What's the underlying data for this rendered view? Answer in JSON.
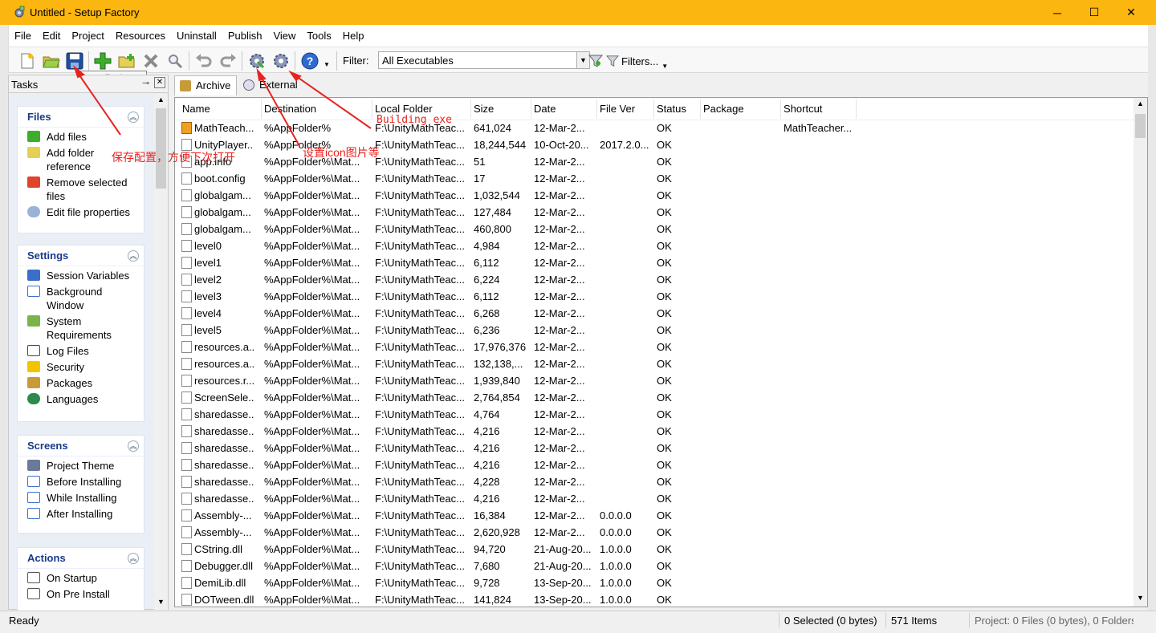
{
  "window": {
    "title": "Untitled - Setup Factory",
    "minimize": "─",
    "maximize": "☐",
    "close": "✕"
  },
  "menu": [
    "File",
    "Edit",
    "Project",
    "Resources",
    "Uninstall",
    "Publish",
    "View",
    "Tools",
    "Help"
  ],
  "toolbar": {
    "tooltip": "Save Project",
    "filter_label": "Filter:",
    "filter_value": "All Executables",
    "filters_button": "Filters..."
  },
  "tasks": {
    "title": "Tasks",
    "files": {
      "title": "Files",
      "items": [
        "Add files",
        "Add folder reference",
        "Remove selected files",
        "Edit file properties"
      ]
    },
    "settings": {
      "title": "Settings",
      "items": [
        "Session Variables",
        "Background Window",
        "System Requirements",
        "Log Files",
        "Security",
        "Packages",
        "Languages"
      ]
    },
    "screens": {
      "title": "Screens",
      "items": [
        "Project Theme",
        "Before Installing",
        "While Installing",
        "After Installing"
      ]
    },
    "actions": {
      "title": "Actions",
      "items": [
        "On Startup",
        "On Pre Install"
      ]
    }
  },
  "tabs": [
    "Archive",
    "External"
  ],
  "grid": {
    "columns": [
      "Name",
      "Destination",
      "Local Folder",
      "Size",
      "Date",
      "File Ver",
      "Status",
      "Package",
      "Shortcut"
    ],
    "rows": [
      [
        "MathTeach...",
        "%AppFolder%",
        "F:\\UnityMathTeac...",
        "641,024",
        "12-Mar-2...",
        "",
        "OK",
        "",
        "MathTeacher..."
      ],
      [
        "UnityPlayer....",
        "%AppFolder%",
        "F:\\UnityMathTeac...",
        "18,244,544",
        "10-Oct-20...",
        "2017.2.0...",
        "OK",
        "",
        ""
      ],
      [
        "app.info",
        "%AppFolder%\\Mat...",
        "F:\\UnityMathTeac...",
        "51",
        "12-Mar-2...",
        "",
        "OK",
        "",
        ""
      ],
      [
        "boot.config",
        "%AppFolder%\\Mat...",
        "F:\\UnityMathTeac...",
        "17",
        "12-Mar-2...",
        "",
        "OK",
        "",
        ""
      ],
      [
        "globalgam...",
        "%AppFolder%\\Mat...",
        "F:\\UnityMathTeac...",
        "1,032,544",
        "12-Mar-2...",
        "",
        "OK",
        "",
        ""
      ],
      [
        "globalgam...",
        "%AppFolder%\\Mat...",
        "F:\\UnityMathTeac...",
        "127,484",
        "12-Mar-2...",
        "",
        "OK",
        "",
        ""
      ],
      [
        "globalgam...",
        "%AppFolder%\\Mat...",
        "F:\\UnityMathTeac...",
        "460,800",
        "12-Mar-2...",
        "",
        "OK",
        "",
        ""
      ],
      [
        "level0",
        "%AppFolder%\\Mat...",
        "F:\\UnityMathTeac...",
        "4,984",
        "12-Mar-2...",
        "",
        "OK",
        "",
        ""
      ],
      [
        "level1",
        "%AppFolder%\\Mat...",
        "F:\\UnityMathTeac...",
        "6,112",
        "12-Mar-2...",
        "",
        "OK",
        "",
        ""
      ],
      [
        "level2",
        "%AppFolder%\\Mat...",
        "F:\\UnityMathTeac...",
        "6,224",
        "12-Mar-2...",
        "",
        "OK",
        "",
        ""
      ],
      [
        "level3",
        "%AppFolder%\\Mat...",
        "F:\\UnityMathTeac...",
        "6,112",
        "12-Mar-2...",
        "",
        "OK",
        "",
        ""
      ],
      [
        "level4",
        "%AppFolder%\\Mat...",
        "F:\\UnityMathTeac...",
        "6,268",
        "12-Mar-2...",
        "",
        "OK",
        "",
        ""
      ],
      [
        "level5",
        "%AppFolder%\\Mat...",
        "F:\\UnityMathTeac...",
        "6,236",
        "12-Mar-2...",
        "",
        "OK",
        "",
        ""
      ],
      [
        "resources.a...",
        "%AppFolder%\\Mat...",
        "F:\\UnityMathTeac...",
        "17,976,376",
        "12-Mar-2...",
        "",
        "OK",
        "",
        ""
      ],
      [
        "resources.a...",
        "%AppFolder%\\Mat...",
        "F:\\UnityMathTeac...",
        "132,138,...",
        "12-Mar-2...",
        "",
        "OK",
        "",
        ""
      ],
      [
        "resources.r...",
        "%AppFolder%\\Mat...",
        "F:\\UnityMathTeac...",
        "1,939,840",
        "12-Mar-2...",
        "",
        "OK",
        "",
        ""
      ],
      [
        "ScreenSele...",
        "%AppFolder%\\Mat...",
        "F:\\UnityMathTeac...",
        "2,764,854",
        "12-Mar-2...",
        "",
        "OK",
        "",
        ""
      ],
      [
        "sharedasse...",
        "%AppFolder%\\Mat...",
        "F:\\UnityMathTeac...",
        "4,764",
        "12-Mar-2...",
        "",
        "OK",
        "",
        ""
      ],
      [
        "sharedasse...",
        "%AppFolder%\\Mat...",
        "F:\\UnityMathTeac...",
        "4,216",
        "12-Mar-2...",
        "",
        "OK",
        "",
        ""
      ],
      [
        "sharedasse...",
        "%AppFolder%\\Mat...",
        "F:\\UnityMathTeac...",
        "4,216",
        "12-Mar-2...",
        "",
        "OK",
        "",
        ""
      ],
      [
        "sharedasse...",
        "%AppFolder%\\Mat...",
        "F:\\UnityMathTeac...",
        "4,216",
        "12-Mar-2...",
        "",
        "OK",
        "",
        ""
      ],
      [
        "sharedasse...",
        "%AppFolder%\\Mat...",
        "F:\\UnityMathTeac...",
        "4,228",
        "12-Mar-2...",
        "",
        "OK",
        "",
        ""
      ],
      [
        "sharedasse...",
        "%AppFolder%\\Mat...",
        "F:\\UnityMathTeac...",
        "4,216",
        "12-Mar-2...",
        "",
        "OK",
        "",
        ""
      ],
      [
        "Assembly-...",
        "%AppFolder%\\Mat...",
        "F:\\UnityMathTeac...",
        "16,384",
        "12-Mar-2...",
        "0.0.0.0",
        "OK",
        "",
        ""
      ],
      [
        "Assembly-...",
        "%AppFolder%\\Mat...",
        "F:\\UnityMathTeac...",
        "2,620,928",
        "12-Mar-2...",
        "0.0.0.0",
        "OK",
        "",
        ""
      ],
      [
        "CString.dll",
        "%AppFolder%\\Mat...",
        "F:\\UnityMathTeac...",
        "94,720",
        "21-Aug-20...",
        "1.0.0.0",
        "OK",
        "",
        ""
      ],
      [
        "Debugger.dll",
        "%AppFolder%\\Mat...",
        "F:\\UnityMathTeac...",
        "7,680",
        "21-Aug-20...",
        "1.0.0.0",
        "OK",
        "",
        ""
      ],
      [
        "DemiLib.dll",
        "%AppFolder%\\Mat...",
        "F:\\UnityMathTeac...",
        "9,728",
        "13-Sep-20...",
        "1.0.0.0",
        "OK",
        "",
        ""
      ],
      [
        "DOTween.dll",
        "%AppFolder%\\Mat...",
        "F:\\UnityMathTeac...",
        "141,824",
        "13-Sep-20...",
        "1.0.0.0",
        "OK",
        "",
        ""
      ]
    ]
  },
  "status": {
    "ready": "Ready",
    "selected": "0 Selected (0 bytes)",
    "items": "571 Items",
    "project": "Project: 0 Files (0 bytes), 0 Folders"
  },
  "annotations": {
    "save": "保存配置，方便下次打开",
    "building": "Building exe",
    "icon": "设置icon图片等"
  },
  "colors": {
    "titlebar": "#fbb60f",
    "section_title": "#1a3a8a",
    "annotation": "#e8231f"
  }
}
